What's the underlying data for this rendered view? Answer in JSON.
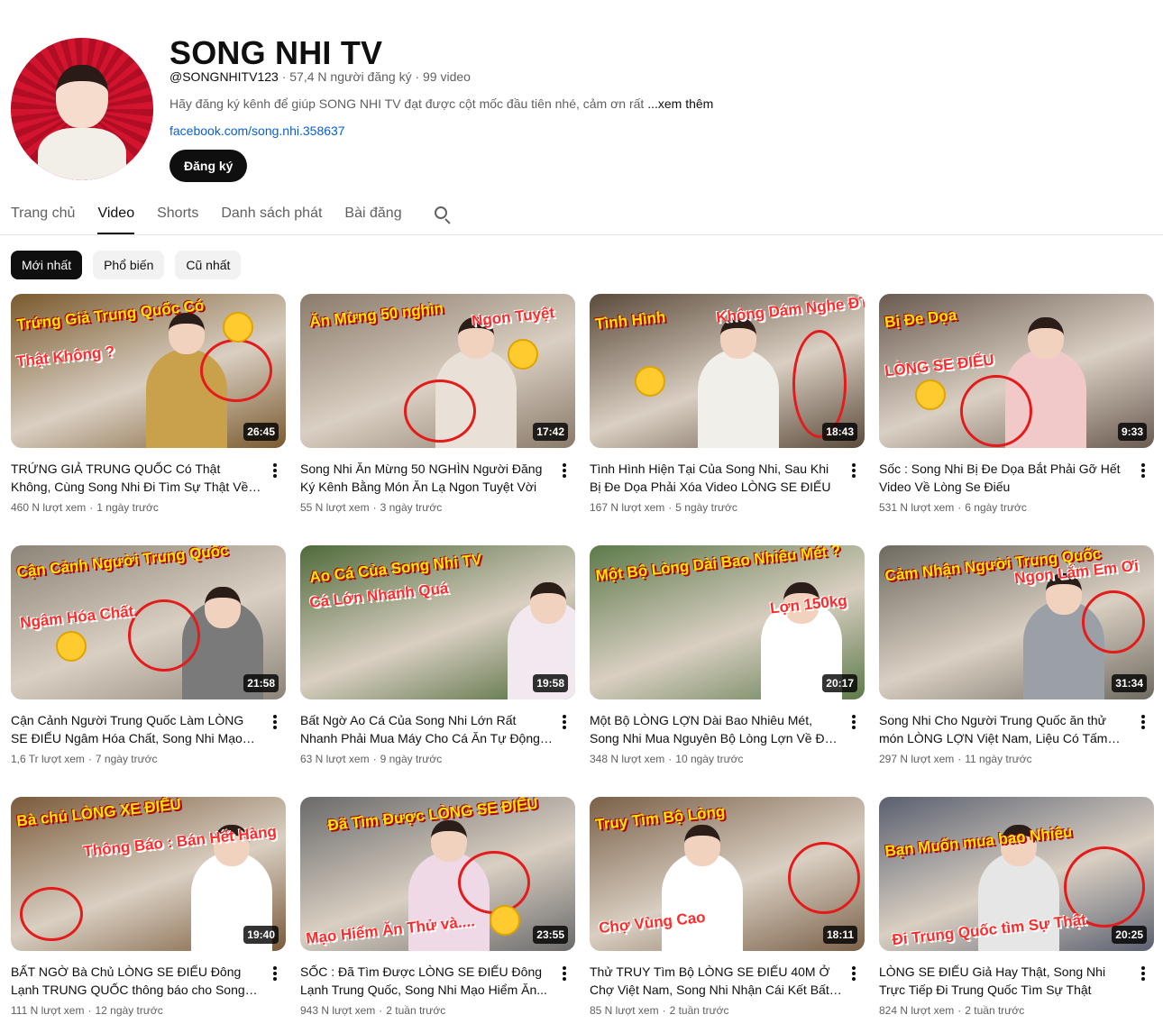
{
  "channel": {
    "title": "SONG NHI TV",
    "handle": "@SONGNHITV123",
    "subscribers": "57,4 N người đăng ký",
    "video_count": "99 video",
    "meta_sep": "·",
    "description": "Hãy đăng ký kênh để giúp SONG NHI TV đạt được cột mốc đầu tiên nhé, cảm ơn rất",
    "more_label": "...xem thêm",
    "link": "facebook.com/song.nhi.358637",
    "subscribe_label": "Đăng ký"
  },
  "tabs": [
    {
      "label": "Trang chủ"
    },
    {
      "label": "Video"
    },
    {
      "label": "Shorts"
    },
    {
      "label": "Danh sách phát"
    },
    {
      "label": "Bài đăng"
    }
  ],
  "chips": [
    {
      "label": "Mới nhất"
    },
    {
      "label": "Phổ biến"
    },
    {
      "label": "Cũ nhất"
    }
  ],
  "videos": [
    {
      "title": "TRỨNG GIẢ TRUNG QUỐC Có Thật Không, Cùng Song Nhi Đi Tìm Sự Thật Về Trứng Giả",
      "views": "460 N lượt xem",
      "age": "1 ngày trước",
      "duration": "26:45",
      "caption1": "Trứng Giả Trung Quốc Có",
      "caption2": "Thật Không ?",
      "bg": "#7a5a2e"
    },
    {
      "title": "Song Nhi Ăn Mừng 50 NGHÌN Người Đăng Ký Kênh Bằng Món Ăn Lạ Ngon Tuyệt Vời",
      "views": "55 N lượt xem",
      "age": "3 ngày trước",
      "duration": "17:42",
      "caption1": "Ăn Mừng 50 nghìn",
      "caption2": "Ngon Tuyệt",
      "bg": "#8a7a6a"
    },
    {
      "title": "Tình Hình Hiện Tại Của Song Nhi, Sau Khi Bị Đe Dọa Phải Xóa Video LÒNG SE ĐIẾU",
      "views": "167 N lượt xem",
      "age": "5 ngày trước",
      "duration": "18:43",
      "caption1": "Tình Hình",
      "caption2": "Không Dám Nghe ĐT",
      "bg": "#5b4a3a"
    },
    {
      "title": "Sốc : Song Nhi Bị Đe Dọa Bắt Phải Gỡ Hết Video Về Lòng Se Điếu",
      "views": "531 N lượt xem",
      "age": "6 ngày trước",
      "duration": "9:33",
      "caption1": "Bị Đe Dọa",
      "caption2": "LÒNG SE ĐIẾU",
      "bg": "#6a5a50"
    },
    {
      "title": "Cận Cảnh Người Trung Quốc Làm LÒNG SE ĐIẾU Ngâm Hóa Chất, Song Nhi Mạo Hiểm...",
      "views": "1,6 Tr lượt xem",
      "age": "7 ngày trước",
      "duration": "21:58",
      "caption1": "Cận Cảnh Người Trung Quốc",
      "caption2": "Ngâm Hóa Chất",
      "bg": "#8c8478"
    },
    {
      "title": "Bất Ngờ Ao Cá Của Song Nhi Lớn Rất Nhanh Phải Mua Máy Cho Cá Ăn Tự Động Mới",
      "views": "63 N lượt xem",
      "age": "9 ngày trước",
      "duration": "19:58",
      "caption1": "Ao Cá Của Song Nhi TV",
      "caption2": "Cá Lớn Nhanh Quá",
      "bg": "#4f6a3a"
    },
    {
      "title": "Một Bộ LÒNG LỢN Dài Bao Nhiêu Mét, Song Nhi Mua Nguyên Bộ Lòng Lợn Về Đo Thử",
      "views": "348 N lượt xem",
      "age": "10 ngày trước",
      "duration": "20:17",
      "caption1": "Một Bộ Lòng Dài Bao Nhiêu Mét ?",
      "caption2": "Lợn 150kg",
      "bg": "#5d7a4a"
    },
    {
      "title": "Song Nhi Cho Người Trung Quốc ăn thử món LÒNG LỢN Việt Nam, Liệu Có Tấm Tắc Khe...",
      "views": "297 N lượt xem",
      "age": "11 ngày trước",
      "duration": "31:34",
      "caption1": "Cảm Nhận Người Trung Quốc",
      "caption2": "Ngon Lắm Em Ơi",
      "bg": "#6e6a60"
    },
    {
      "title": "BẤT NGỜ Bà Chủ LÒNG SE ĐIẾU Đông Lạnh TRUNG QUỐC thông báo cho Song Nhi Đã...",
      "views": "111 N lượt xem",
      "age": "12 ngày trước",
      "duration": "19:40",
      "caption1": "Bà chủ LÒNG XE ĐIẾU",
      "caption2": "Thông Báo : Bán Hết Hàng",
      "bg": "#7a5a3a"
    },
    {
      "title": "SỐC : Đã Tìm Được LÒNG SE ĐIẾU Đông Lạnh Trung Quốc, Song Nhi Mạo Hiểm Ăn...",
      "views": "943 N lượt xem",
      "age": "2 tuần trước",
      "duration": "23:55",
      "caption1": "Đã Tìm Được LÒNG SE ĐIẾU",
      "caption2": "Mạo Hiểm Ăn Thử và....",
      "bg": "#6a6a6a"
    },
    {
      "title": "Thử TRUY Tìm Bộ LÒNG SE ĐIẾU 40M Ở Chợ Việt Nam, Song Nhi Nhận Cái Kết Bất Ngờ",
      "views": "85 N lượt xem",
      "age": "2 tuần trước",
      "duration": "18:11",
      "caption1": "Truy Tìm Bộ Lòng",
      "caption2": "Chợ Vùng Cao",
      "bg": "#7a6048"
    },
    {
      "title": "LÒNG SE ĐIẾU Giả Hay Thật, Song Nhi Trực Tiếp Đi Trung Quốc Tìm Sự Thật",
      "views": "824 N lượt xem",
      "age": "2 tuần trước",
      "duration": "20:25",
      "caption1": "Bạn Muốn mua bao Nhiêu",
      "caption2": "Đi Trung Quốc tìm Sự Thật",
      "bg": "#5a6070"
    }
  ],
  "meta_sep": "·"
}
